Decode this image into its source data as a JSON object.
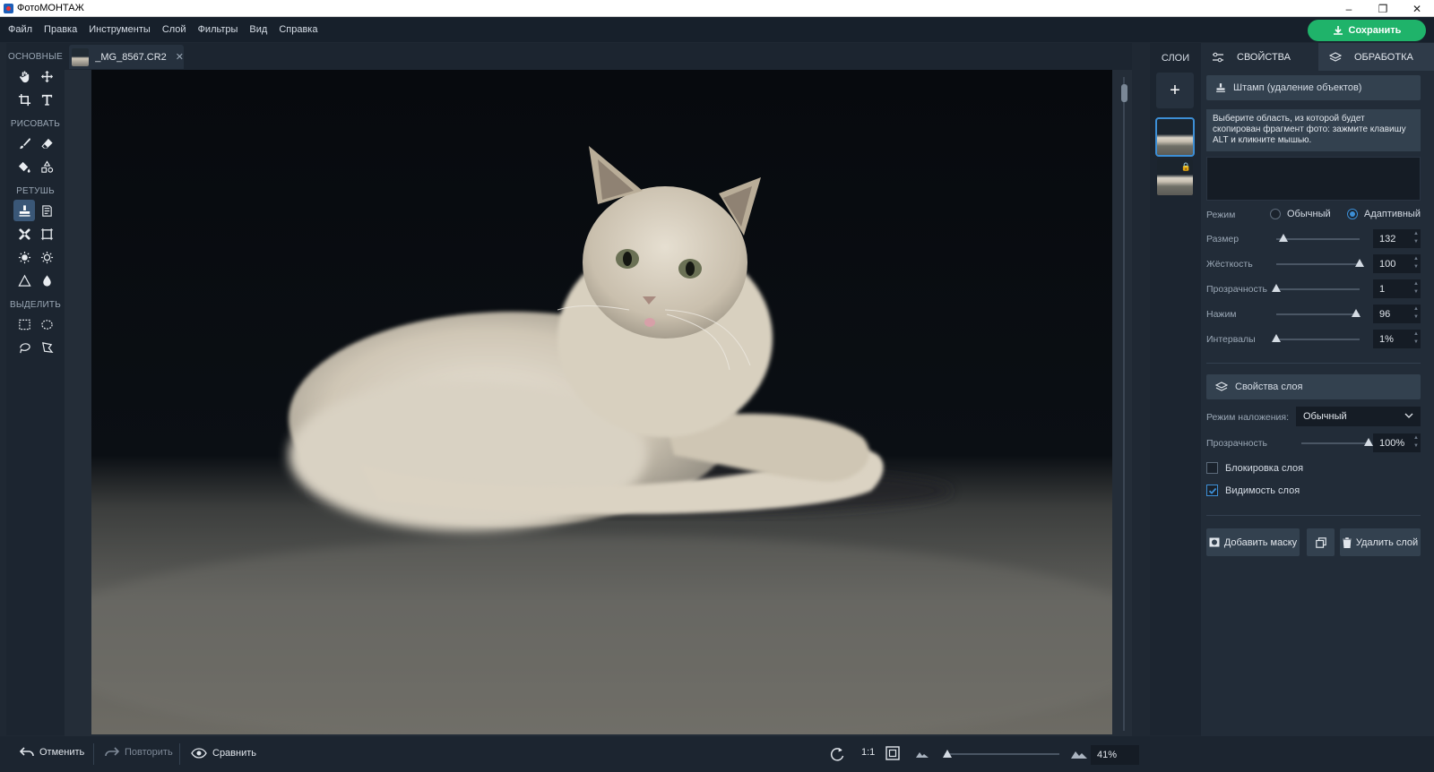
{
  "window": {
    "title": "ФотоМОНТАЖ",
    "controls": [
      "–",
      "❐",
      "✕"
    ]
  },
  "menu": [
    "Файл",
    "Правка",
    "Инструменты",
    "Слой",
    "Фильтры",
    "Вид",
    "Справка"
  ],
  "save_label": "Сохранить",
  "tools": {
    "groups": [
      "ОСНОВНЫЕ",
      "РИСОВАТЬ",
      "РЕТУШЬ",
      "ВЫДЕЛИТЬ"
    ],
    "active_tool": "stamp-tool"
  },
  "document_tab": {
    "name": "_MG_8567.CR2",
    "close": "✕"
  },
  "layers": {
    "title": "СЛОИ",
    "add": "+",
    "lock_glyph": "🔒"
  },
  "panel": {
    "tabs": [
      "СВОЙСТВА",
      "ОБРАБОТКА"
    ],
    "tool_header": "Штамп (удаление объектов)",
    "hint": "Выберите область, из которой будет скопирован фрагмент фото: зажмите клавишу ALT и кликните мышью.",
    "mode_label": "Режим",
    "mode_options": [
      "Обычный",
      "Адаптивный"
    ],
    "mode_selected": "Адаптивный",
    "params": [
      {
        "label": "Размер",
        "value": "132",
        "level": 0.09
      },
      {
        "label": "Жёсткость",
        "value": "100",
        "level": 1.0
      },
      {
        "label": "Прозрачность",
        "value": "1",
        "level": 0.0
      },
      {
        "label": "Нажим",
        "value": "96",
        "level": 0.96
      },
      {
        "label": "Интервалы",
        "value": "1%",
        "level": 0.0
      }
    ],
    "layer_props_header": "Свойства слоя",
    "blend_label": "Режим наложения:",
    "blend_value": "Обычный",
    "opacity_label": "Прозрачность",
    "opacity_value": "100%",
    "opacity_level": 1.0,
    "lock_layer_label": "Блокировка слоя",
    "lock_layer_checked": false,
    "visible_layer_label": "Видимость слоя",
    "visible_layer_checked": true,
    "add_mask": "Добавить маску",
    "delete_layer": "Удалить слой"
  },
  "bottom": {
    "undo": "Отменить",
    "redo": "Повторить",
    "compare": "Сравнить",
    "one_to_one": "1:1",
    "zoom": "41%",
    "zoom_level": 0.02
  },
  "colors": {
    "accent": "#3d8fd6",
    "save_green": "#1fb36a",
    "panel_bg": "#222c38"
  }
}
